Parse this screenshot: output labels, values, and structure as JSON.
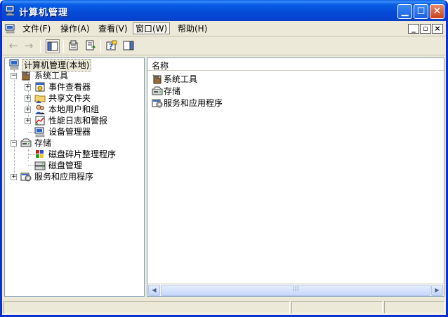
{
  "window": {
    "title": "计算机管理"
  },
  "menu": [
    {
      "label": "文件(F)"
    },
    {
      "label": "操作(A)"
    },
    {
      "label": "查看(V)"
    },
    {
      "label": "窗口(W)"
    },
    {
      "label": "帮助(H)"
    }
  ],
  "tree": {
    "root": "计算机管理(本地)",
    "system_tools": "系统工具",
    "event_viewer": "事件查看器",
    "shared_folders": "共享文件夹",
    "local_users": "本地用户和组",
    "perf_logs": "性能日志和警报",
    "device_manager": "设备管理器",
    "storage": "存储",
    "defrag": "磁盘碎片整理程序",
    "disk_mgmt": "磁盘管理",
    "services_apps": "服务和应用程序"
  },
  "list": {
    "column_name": "名称",
    "items": [
      {
        "label": "系统工具"
      },
      {
        "label": "存储"
      },
      {
        "label": "服务和应用程序"
      }
    ]
  },
  "colors": {
    "titlebar": "#0549d6",
    "chrome": "#ece9d8",
    "pane_border": "#7f9db9"
  }
}
